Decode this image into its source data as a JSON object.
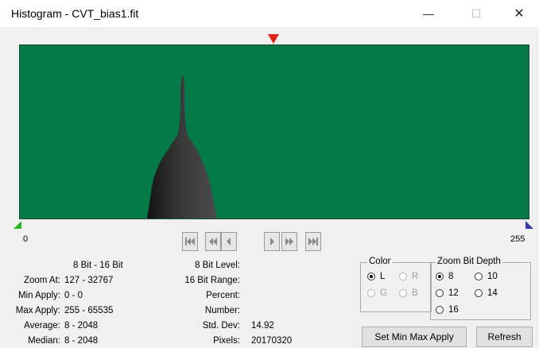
{
  "window": {
    "title": "Histogram - CVT_bias1.fit",
    "minimize_glyph": "—",
    "maximize_glyph": "☐",
    "close_glyph": "✕"
  },
  "histogram": {
    "background_color": "#037a48",
    "fill_color": "#3a3a3a",
    "top_marker_color": "#e0231b",
    "min_marker_color": "#2db82d",
    "max_marker_color": "#3a3aa8"
  },
  "scale": {
    "min_label": "0",
    "max_label": "255"
  },
  "nav_icons": [
    "first-icon",
    "rewind-icon",
    "step-back-icon",
    "step-forward-icon",
    "fast-forward-icon",
    "last-icon"
  ],
  "stats": {
    "header": "8 Bit - 16 Bit",
    "zoom_at_label": "Zoom At:",
    "zoom_at_value": "127 - 32767",
    "min_apply_label": "Min Apply:",
    "min_apply_value": "0 - 0",
    "max_apply_label": "Max Apply:",
    "max_apply_value": "255 - 65535",
    "average_label": "Average:",
    "average_value": "8 - 2048",
    "median_label": "Median:",
    "median_value": "8 - 2048"
  },
  "level": {
    "bit8_level_label": "8 Bit Level:",
    "bit8_level_value": "",
    "bit16_range_label": "16 Bit Range:",
    "bit16_range_value": "",
    "percent_label": "Percent:",
    "percent_value": "",
    "number_label": "Number:",
    "number_value": "",
    "std_dev_label": "Std. Dev:",
    "std_dev_value": "14.92",
    "pixels_label": "Pixels:",
    "pixels_value": "20170320"
  },
  "color_group": {
    "legend": "Color",
    "options": [
      "L",
      "R",
      "G",
      "B"
    ],
    "selected": "L"
  },
  "zoom_group": {
    "legend": "Zoom Bit Depth",
    "options": [
      "8",
      "10",
      "12",
      "14",
      "16"
    ],
    "selected": "8"
  },
  "buttons": {
    "set_min_max": "Set Min Max Apply",
    "refresh": "Refresh"
  }
}
